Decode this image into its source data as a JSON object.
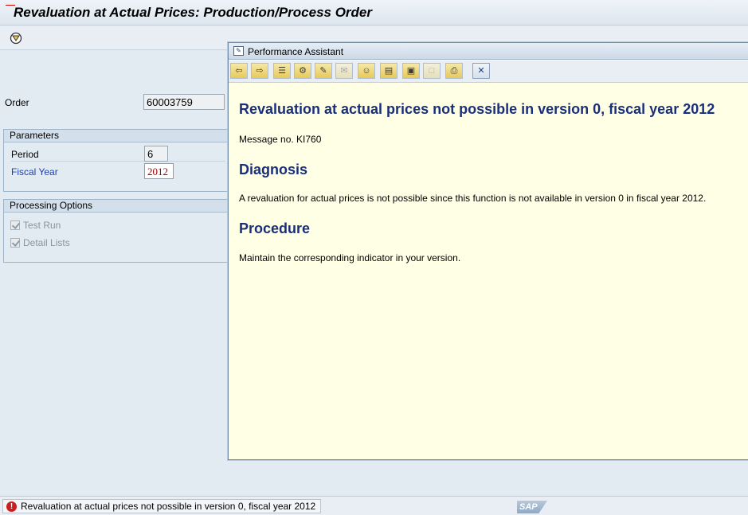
{
  "window": {
    "title": "Revaluation at Actual Prices: Production/Process Order"
  },
  "toolbar": {
    "execute_icon": "execute-icon"
  },
  "form": {
    "order_label": "Order",
    "order_value": "60003759",
    "parameters": {
      "header": "Parameters",
      "period_label": "Period",
      "period_value": "6",
      "fiscal_year_label": "Fiscal Year",
      "fiscal_year_value": "2012"
    },
    "processing_options": {
      "header": "Processing Options",
      "test_run_label": "Test Run",
      "test_run_checked": true,
      "detail_lists_label": "Detail Lists",
      "detail_lists_checked": true
    }
  },
  "performance_assistant": {
    "title": "Performance Assistant",
    "heading": "Revaluation at actual prices not possible in version 0, fiscal year 2012",
    "message_no": "Message no. KI760",
    "diagnosis_heading": "Diagnosis",
    "diagnosis_text": "A revaluation for actual prices is not possible since this function is not available in version 0 in fiscal year 2012.",
    "procedure_heading": "Procedure",
    "procedure_text": "Maintain the corresponding indicator in your version."
  },
  "status_bar": {
    "type": "error",
    "message": "Revaluation at actual prices not possible in version 0, fiscal year 2012",
    "logo": "SAP"
  },
  "colors": {
    "heading_blue": "#1a2f7c",
    "assistant_background": "#ffffe5",
    "error_red": "#cc1e1e",
    "required_value": "#a00000"
  }
}
